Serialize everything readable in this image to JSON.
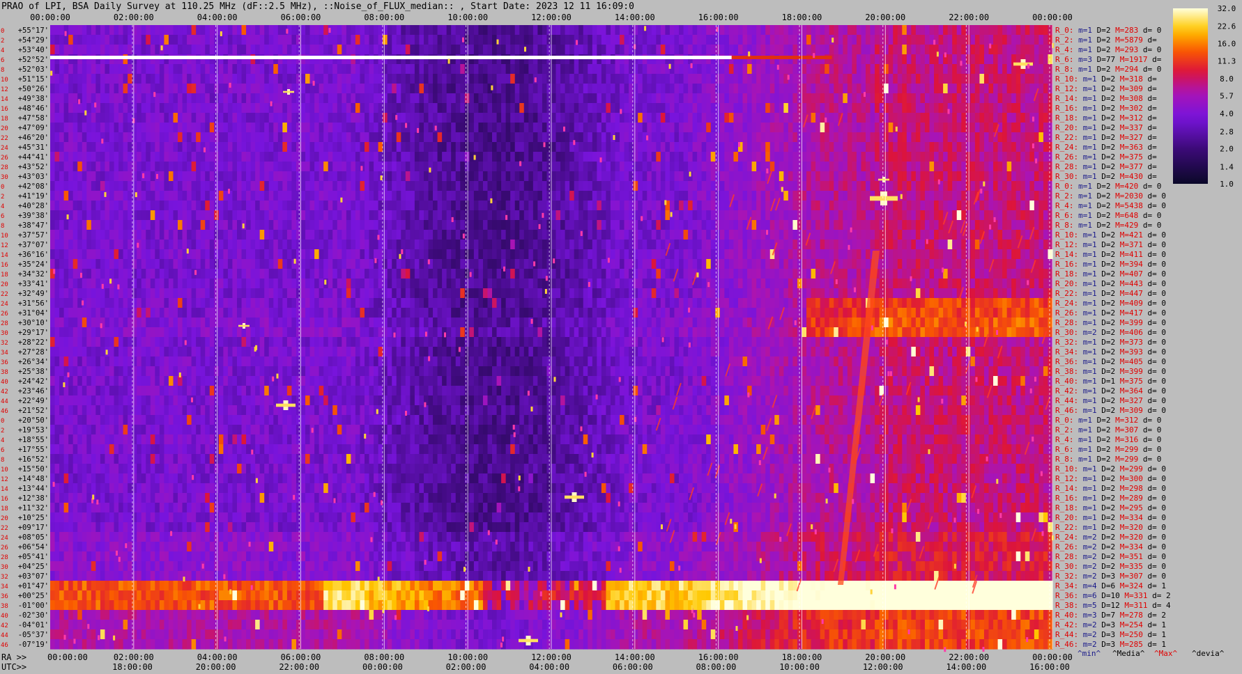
{
  "title": "PRAO of LPI, BSA Daily Survey at 110.25 MHz (dF::2.5 MHz), ::Noise_of_FLUX_median:: , Start Date: 2023 12 11 16:09:0",
  "chart_data": {
    "type": "heatmap",
    "title": "PRAO of LPI, BSA Daily Survey at 110.25 MHz (dF::2.5 MHz), ::Noise_of_FLUX_median:: , Start Date: 2023 12 11 16:09:0",
    "x_ra_ticks": [
      "00:00:00",
      "02:00:00",
      "04:00:00",
      "06:00:00",
      "08:00:00",
      "10:00:00",
      "12:00:00",
      "14:00:00",
      "16:00:00",
      "18:00:00",
      "20:00:00",
      "22:00:00",
      "00:00:00"
    ],
    "x_utc_ticks": [
      "18:00:00",
      "20:00:00",
      "22:00:00",
      "00:00:00",
      "02:00:00",
      "04:00:00",
      "06:00:00",
      "08:00:00",
      "10:00:00",
      "12:00:00",
      "14:00:00",
      "16:00:00"
    ],
    "x_ra_prefix": "RA >>",
    "x_utc_prefix": "UTC>>",
    "y_ticks": [
      "+55°17'",
      "+54°29'",
      "+53°40'",
      "+52°52'",
      "+52°03'",
      "+51°15'",
      "+50°26'",
      "+49°38'",
      "+48°46'",
      "+47°58'",
      "+47°09'",
      "+46°20'",
      "+45°31'",
      "+44°41'",
      "+43°52'",
      "+43°03'",
      "+42°08'",
      "+41°19'",
      "+40°28'",
      "+39°38'",
      "+38°47'",
      "+37°57'",
      "+37°07'",
      "+36°16'",
      "+35°24'",
      "+34°32'",
      "+33°41'",
      "+32°49'",
      "+31°56'",
      "+31°04'",
      "+30°10'",
      "+29°17'",
      "+28°22'",
      "+27°28'",
      "+26°34'",
      "+25°38'",
      "+24°42'",
      "+23°46'",
      "+22°49'",
      "+21°52'",
      "+20°50'",
      "+19°53'",
      "+18°55'",
      "+17°55'",
      "+16°52'",
      "+15°50'",
      "+14°48'",
      "+13°44'",
      "+12°38'",
      "+11°32'",
      "+10°25'",
      "+09°17'",
      "+08°05'",
      "+06°54'",
      "+05°41'",
      "+04°25'",
      "+03°07'",
      "+01°47'",
      "+00°25'",
      "-01°00'",
      "-02°30'",
      "-04°01'",
      "-05°37'",
      "-07°19'"
    ],
    "colorbar_ticks": [
      "32.0",
      "22.6",
      "16.0",
      "11.3",
      "8.0",
      "5.7",
      "4.0",
      "2.8",
      "2.0",
      "1.4",
      "1.0"
    ],
    "colorbar_range": [
      1.0,
      32.0
    ],
    "colorbar_scale": "log",
    "rows": [
      {
        "r": "R_0:",
        "m": "m=1",
        "d": "D=2",
        "M": "M=283",
        "dv": "d= 0"
      },
      {
        "r": "R_2:",
        "m": "m=1",
        "d": "D=2",
        "M": "M=5879",
        "dv": "d="
      },
      {
        "r": "R_4:",
        "m": "m=1",
        "d": "D=2",
        "M": "M=293",
        "dv": "d= 0"
      },
      {
        "r": "R_6:",
        "m": "m=3",
        "d": "D=77",
        "M": "M=1917",
        "dv": "d="
      },
      {
        "r": "R_8:",
        "m": "m=1",
        "d": "D=2",
        "M": "M=294",
        "dv": "d= 0"
      },
      {
        "r": "R_10:",
        "m": "m=1",
        "d": "D=2",
        "M": "M=318",
        "dv": "d="
      },
      {
        "r": "R_12:",
        "m": "m=1",
        "d": "D=2",
        "M": "M=309",
        "dv": "d="
      },
      {
        "r": "R_14:",
        "m": "m=1",
        "d": "D=2",
        "M": "M=308",
        "dv": "d="
      },
      {
        "r": "R_16:",
        "m": "m=1",
        "d": "D=2",
        "M": "M=302",
        "dv": "d="
      },
      {
        "r": "R_18:",
        "m": "m=1",
        "d": "D=2",
        "M": "M=312",
        "dv": "d="
      },
      {
        "r": "R_20:",
        "m": "m=1",
        "d": "D=2",
        "M": "M=337",
        "dv": "d="
      },
      {
        "r": "R_22:",
        "m": "m=1",
        "d": "D=2",
        "M": "M=327",
        "dv": "d="
      },
      {
        "r": "R_24:",
        "m": "m=1",
        "d": "D=2",
        "M": "M=363",
        "dv": "d="
      },
      {
        "r": "R_26:",
        "m": "m=1",
        "d": "D=2",
        "M": "M=375",
        "dv": "d="
      },
      {
        "r": "R_28:",
        "m": "m=1",
        "d": "D=2",
        "M": "M=377",
        "dv": "d="
      },
      {
        "r": "R_30:",
        "m": "m=1",
        "d": "D=2",
        "M": "M=430",
        "dv": "d="
      },
      {
        "r": "R_0:",
        "m": "m=1",
        "d": "D=2",
        "M": "M=420",
        "dv": "d= 0"
      },
      {
        "r": "R_2:",
        "m": "m=1",
        "d": "D=2",
        "M": "M=2030",
        "dv": "d= 0"
      },
      {
        "r": "R_4:",
        "m": "m=1",
        "d": "D=2",
        "M": "M=5438",
        "dv": "d= 0"
      },
      {
        "r": "R_6:",
        "m": "m=1",
        "d": "D=2",
        "M": "M=648",
        "dv": "d= 0"
      },
      {
        "r": "R_8:",
        "m": "m=1",
        "d": "D=2",
        "M": "M=429",
        "dv": "d= 0"
      },
      {
        "r": "R_10:",
        "m": "m=1",
        "d": "D=2",
        "M": "M=421",
        "dv": "d= 0"
      },
      {
        "r": "R_12:",
        "m": "m=1",
        "d": "D=2",
        "M": "M=371",
        "dv": "d= 0"
      },
      {
        "r": "R_14:",
        "m": "m=1",
        "d": "D=2",
        "M": "M=411",
        "dv": "d= 0"
      },
      {
        "r": "R_16:",
        "m": "m=1",
        "d": "D=2",
        "M": "M=394",
        "dv": "d= 0"
      },
      {
        "r": "R_18:",
        "m": "m=1",
        "d": "D=2",
        "M": "M=407",
        "dv": "d= 0"
      },
      {
        "r": "R_20:",
        "m": "m=1",
        "d": "D=2",
        "M": "M=443",
        "dv": "d= 0"
      },
      {
        "r": "R_22:",
        "m": "m=1",
        "d": "D=2",
        "M": "M=447",
        "dv": "d= 0"
      },
      {
        "r": "R_24:",
        "m": "m=1",
        "d": "D=2",
        "M": "M=409",
        "dv": "d= 0"
      },
      {
        "r": "R_26:",
        "m": "m=1",
        "d": "D=2",
        "M": "M=417",
        "dv": "d= 0"
      },
      {
        "r": "R_28:",
        "m": "m=1",
        "d": "D=2",
        "M": "M=399",
        "dv": "d= 0"
      },
      {
        "r": "R_30:",
        "m": "m=2",
        "d": "D=2",
        "M": "M=406",
        "dv": "d= 0"
      },
      {
        "r": "R_32:",
        "m": "m=1",
        "d": "D=2",
        "M": "M=373",
        "dv": "d= 0"
      },
      {
        "r": "R_34:",
        "m": "m=1",
        "d": "D=2",
        "M": "M=393",
        "dv": "d= 0"
      },
      {
        "r": "R_36:",
        "m": "m=1",
        "d": "D=2",
        "M": "M=405",
        "dv": "d= 0"
      },
      {
        "r": "R_38:",
        "m": "m=1",
        "d": "D=2",
        "M": "M=399",
        "dv": "d= 0"
      },
      {
        "r": "R_40:",
        "m": "m=1",
        "d": "D=1",
        "M": "M=375",
        "dv": "d= 0"
      },
      {
        "r": "R_42:",
        "m": "m=1",
        "d": "D=2",
        "M": "M=364",
        "dv": "d= 0"
      },
      {
        "r": "R_44:",
        "m": "m=1",
        "d": "D=2",
        "M": "M=327",
        "dv": "d= 0"
      },
      {
        "r": "R_46:",
        "m": "m=1",
        "d": "D=2",
        "M": "M=309",
        "dv": "d= 0"
      },
      {
        "r": "R_0:",
        "m": "m=1",
        "d": "D=2",
        "M": "M=312",
        "dv": "d= 0"
      },
      {
        "r": "R_2:",
        "m": "m=1",
        "d": "D=2",
        "M": "M=307",
        "dv": "d= 0"
      },
      {
        "r": "R_4:",
        "m": "m=1",
        "d": "D=2",
        "M": "M=316",
        "dv": "d= 0"
      },
      {
        "r": "R_6:",
        "m": "m=1",
        "d": "D=2",
        "M": "M=299",
        "dv": "d= 0"
      },
      {
        "r": "R_8:",
        "m": "m=1",
        "d": "D=2",
        "M": "M=299",
        "dv": "d= 0"
      },
      {
        "r": "R_10:",
        "m": "m=1",
        "d": "D=2",
        "M": "M=299",
        "dv": "d= 0"
      },
      {
        "r": "R_12:",
        "m": "m=1",
        "d": "D=2",
        "M": "M=300",
        "dv": "d= 0"
      },
      {
        "r": "R_14:",
        "m": "m=1",
        "d": "D=2",
        "M": "M=298",
        "dv": "d= 0"
      },
      {
        "r": "R_16:",
        "m": "m=1",
        "d": "D=2",
        "M": "M=289",
        "dv": "d= 0"
      },
      {
        "r": "R_18:",
        "m": "m=1",
        "d": "D=2",
        "M": "M=295",
        "dv": "d= 0"
      },
      {
        "r": "R_20:",
        "m": "m=1",
        "d": "D=2",
        "M": "M=334",
        "dv": "d= 0"
      },
      {
        "r": "R_22:",
        "m": "m=1",
        "d": "D=2",
        "M": "M=320",
        "dv": "d= 0"
      },
      {
        "r": "R_24:",
        "m": "m=2",
        "d": "D=2",
        "M": "M=320",
        "dv": "d= 0"
      },
      {
        "r": "R_26:",
        "m": "m=2",
        "d": "D=2",
        "M": "M=334",
        "dv": "d= 0"
      },
      {
        "r": "R_28:",
        "m": "m=2",
        "d": "D=2",
        "M": "M=351",
        "dv": "d= 0"
      },
      {
        "r": "R_30:",
        "m": "m=2",
        "d": "D=2",
        "M": "M=335",
        "dv": "d= 0"
      },
      {
        "r": "R_32:",
        "m": "m=2",
        "d": "D=3",
        "M": "M=307",
        "dv": "d= 0"
      },
      {
        "r": "R_34:",
        "m": "m=4",
        "d": "D=6",
        "M": "M=324",
        "dv": "d= 1"
      },
      {
        "r": "R_36:",
        "m": "m=6",
        "d": "D=10",
        "M": "M=331",
        "dv": "d= 2"
      },
      {
        "r": "R_38:",
        "m": "m=5",
        "d": "D=12",
        "M": "M=311",
        "dv": "d= 4"
      },
      {
        "r": "R_40:",
        "m": "m=3",
        "d": "D=7",
        "M": "M=278",
        "dv": "d= 2"
      },
      {
        "r": "R_42:",
        "m": "m=2",
        "d": "D=3",
        "M": "M=254",
        "dv": "d= 1"
      },
      {
        "r": "R_44:",
        "m": "m=2",
        "d": "D=3",
        "M": "M=250",
        "dv": "d= 1"
      },
      {
        "r": "R_46:",
        "m": "m=2",
        "d": "D=3",
        "M": "M=285",
        "dv": "d= 1"
      }
    ],
    "footer_legend": [
      "^min^",
      "^Media^",
      "^Max^",
      "^devia^"
    ],
    "colors": {
      "background": "#bdbdbd",
      "label_red": "#e00000",
      "label_black": "#000000",
      "label_blue": "#1a1a8a",
      "legend_max": "#e00000"
    }
  }
}
